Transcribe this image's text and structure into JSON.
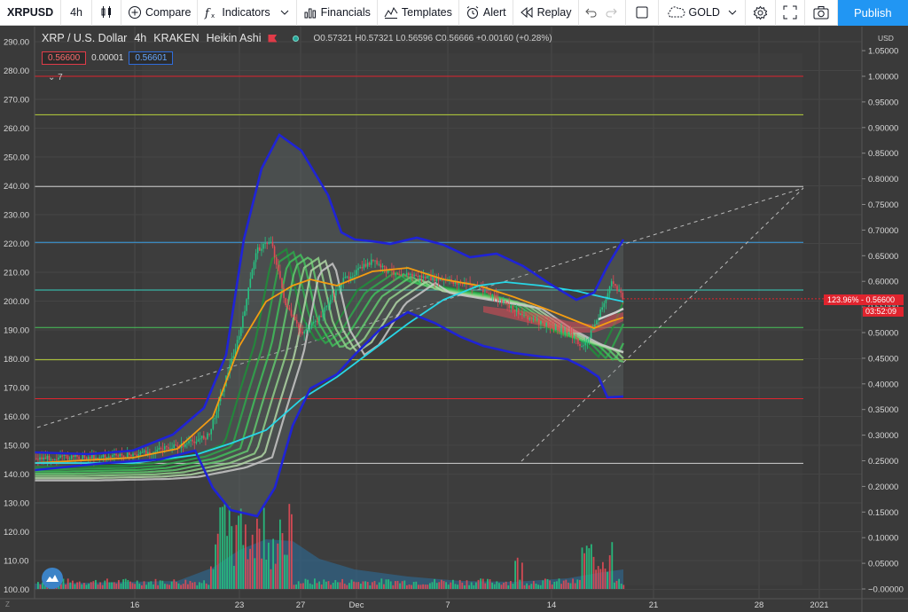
{
  "toolbar": {
    "symbol": "XRPUSD",
    "interval": "4h",
    "compare": "Compare",
    "indicators": "Indicators",
    "financials": "Financials",
    "templates": "Templates",
    "alert": "Alert",
    "replay": "Replay",
    "gold": "GOLD",
    "publish": "Publish"
  },
  "legend": {
    "title": "XRP / U.S. Dollar",
    "interval": "4h",
    "exchange": "KRAKEN",
    "chart_style": "Heikin Ashi",
    "ohlc": "O0.57321 H0.57321 L0.56596 C0.56666 +0.00160 (+0.28%)",
    "bid": "0.56600",
    "spread": "0.00001",
    "ask": "0.56601",
    "studies_count": "7"
  },
  "axis": {
    "currency": "USD",
    "price_tag": "123.96% - 0.56600",
    "time_tag": "03:52:09",
    "z_label": "Z"
  },
  "colors": {
    "background": "#3a3a3a",
    "up": "#26c281",
    "down": "#e04a55",
    "bollinger": "#1f23d6",
    "ema_long": "#27d6e6",
    "ema_short": "#f39c12",
    "accent": "#2196f3",
    "price_tag": "#e0242e"
  },
  "chart_data": {
    "type": "candlestick",
    "title": "XRP / U.S. Dollar",
    "left_axis_ticks": [
      "290.00",
      "280.00",
      "270.00",
      "260.00",
      "250.00",
      "240.00",
      "230.00",
      "220.00",
      "210.00",
      "200.00",
      "190.00",
      "180.00",
      "170.00",
      "160.00",
      "150.00",
      "140.00",
      "130.00",
      "120.00",
      "110.00",
      "100.00"
    ],
    "right_axis_ticks": [
      "1.05000",
      "1.00000",
      "0.95000",
      "0.90000",
      "0.85000",
      "0.80000",
      "0.75000",
      "0.70000",
      "0.65000",
      "0.60000",
      "0.55000",
      "0.50000",
      "0.45000",
      "0.40000",
      "0.35000",
      "0.30000",
      "0.25000",
      "0.20000",
      "0.15000",
      "0.10000",
      "0.05000",
      "−0.00000"
    ],
    "x_ticks": [
      "16",
      "23",
      "27",
      "Dec",
      "7",
      "14",
      "21",
      "28",
      "2021"
    ],
    "ylim": [
      0,
      1.05
    ],
    "last_price": 0.566,
    "horizontal_levels": [
      {
        "value": 1.0,
        "color": "#e0242e"
      },
      {
        "value": 0.925,
        "color": "#b8d23a"
      },
      {
        "value": 0.785,
        "color": "#d0d0d0"
      },
      {
        "value": 0.676,
        "color": "#3ba0e6"
      },
      {
        "value": 0.583,
        "color": "#36d1c0"
      },
      {
        "value": 0.51,
        "color": "#48c55a"
      },
      {
        "value": 0.447,
        "color": "#b8d23a"
      },
      {
        "value": 0.371,
        "color": "#e0242e"
      },
      {
        "value": 0.245,
        "color": "#d0d0d0"
      }
    ],
    "price_path": [
      [
        "Nov 10",
        0.255
      ],
      [
        "Nov 14",
        0.258
      ],
      [
        "Nov 16",
        0.262
      ],
      [
        "Nov 19",
        0.28
      ],
      [
        "Nov 21",
        0.3
      ],
      [
        "Nov 22",
        0.4
      ],
      [
        "Nov 23",
        0.5
      ],
      [
        "Nov 24",
        0.66
      ],
      [
        "Nov 25",
        0.68
      ],
      [
        "Nov 26",
        0.55
      ],
      [
        "Nov 27",
        0.5
      ],
      [
        "Nov 28",
        0.52
      ],
      [
        "Nov 30",
        0.6
      ],
      [
        "Dec 1",
        0.62
      ],
      [
        "Dec 2",
        0.64
      ],
      [
        "Dec 3",
        0.62
      ],
      [
        "Dec 5",
        0.61
      ],
      [
        "Dec 7",
        0.6
      ],
      [
        "Dec 9",
        0.59
      ],
      [
        "Dec 11",
        0.55
      ],
      [
        "Dec 13",
        0.52
      ],
      [
        "Dec 15",
        0.5
      ],
      [
        "Dec 16",
        0.47
      ],
      [
        "Dec 17",
        0.53
      ],
      [
        "Dec 18",
        0.6
      ],
      [
        "Dec 19",
        0.566
      ]
    ],
    "volume_note": "green/red volume bars with blue volume MA area"
  }
}
